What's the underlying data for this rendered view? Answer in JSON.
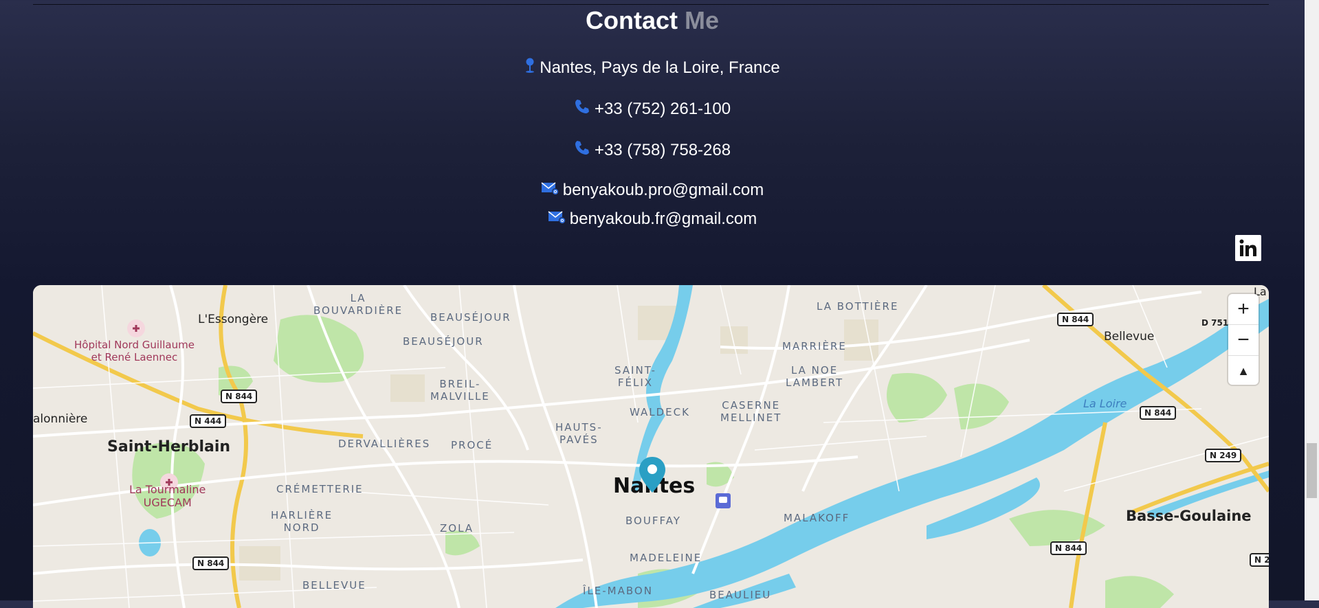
{
  "heading": {
    "main": "Contact",
    "accent": "Me"
  },
  "contact": {
    "address": "Nantes, Pays de la Loire, France",
    "phone1": "+33 (752) 261-100",
    "phone2": "+33 (758) 758-268",
    "email1": "benyakoub.pro@gmail.com",
    "email2": "benyakoub.fr@gmail.com"
  },
  "icons": {
    "location": "location-pin-icon",
    "phone": "phone-icon",
    "email": "email-icon",
    "linkedin": "linkedin-icon"
  },
  "colors": {
    "icon_blue": "#2f6fe0",
    "accent_muted": "#8a8d9b",
    "water": "#76cdeb",
    "park": "#bfe5a8",
    "marker": "#2a9fc4"
  },
  "map": {
    "labels": {
      "essongere": "L'Essongère",
      "bouvardiere": "LA\nBOUVARDIÈRE",
      "beausejour1": "BEAUSÉJOUR",
      "beausejour2": "BEAUSÉJOUR",
      "hopital": "Hôpital Nord Guillaume\net René Laennec",
      "breil": "BREIL-\nMALVILLE",
      "saint_felix": "SAINT-\nFÉLIX",
      "bottiere": "LA BOTTIÈRE",
      "marriere": "MARRIÈRE",
      "noe_lambert": "LA NOE\nLAMBERT",
      "bellevue_ne": "Bellevue",
      "walecck": "WALDECK",
      "caserne": "CASERNE\nMELLINET",
      "la_loire": "La Loire",
      "alonniere": "alonnière",
      "saint_herblain": "Saint-Herblain",
      "dervallieres": "DERVALLIÈRES",
      "proce": "PROCÉ",
      "hauts_paves": "HAUTS-\nPAVÉS",
      "tourmaline": "La Tourmaline\nUGECAM",
      "cremetterie": "CRÉMETTERIE",
      "nantes": "Nantes",
      "bouffay": "BOUFFAY",
      "malakoff": "MALAKOFF",
      "basse_goulaine": "Basse-Goulaine",
      "harliere": "HARLIÈRE\nNORD",
      "zola": "ZOLA",
      "madeleine": "MADELEINE",
      "bellevue_sw": "BELLEVUE",
      "ile_mabon": "ÎLE-MABON",
      "beaulieu": "BEAULIEU",
      "top_right_cut": "La B"
    },
    "roads": {
      "r1": "N 844",
      "r2": "N 444",
      "r3": "N 844",
      "r4": "N 844",
      "r5": "N 844",
      "r6": "N 249",
      "r7": "N 844",
      "r8": "D 751",
      "r9": "N 2"
    },
    "controls": {
      "zoom_in": "+",
      "zoom_out": "−",
      "reset_north": "▲"
    }
  }
}
